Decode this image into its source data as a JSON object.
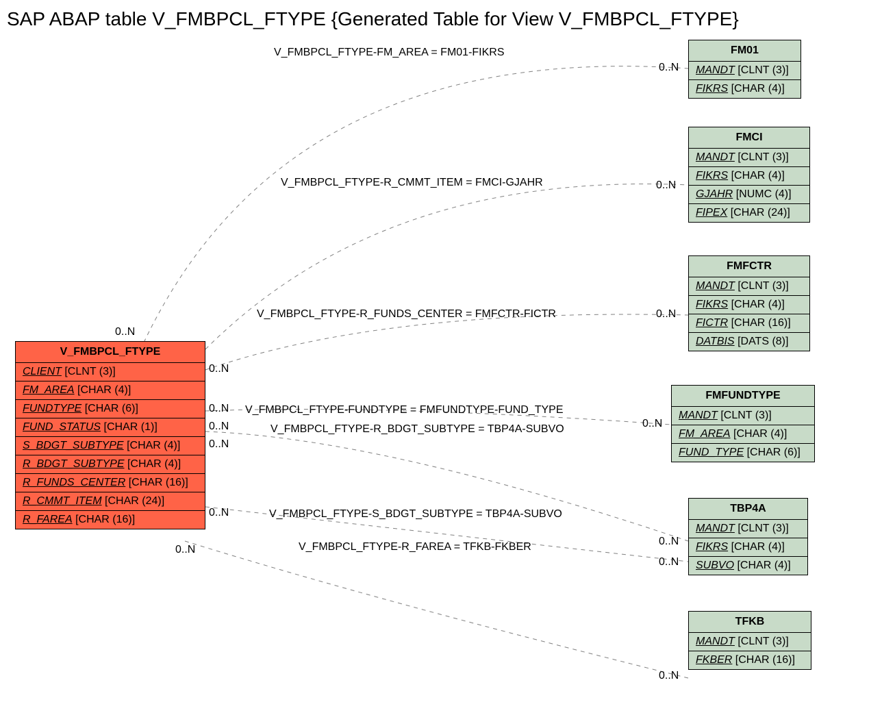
{
  "title": "SAP ABAP table V_FMBPCL_FTYPE {Generated Table for View V_FMBPCL_FTYPE}",
  "main_entity": {
    "name": "V_FMBPCL_FTYPE",
    "fields": [
      {
        "name": "CLIENT",
        "type": "[CLNT (3)]"
      },
      {
        "name": "FM_AREA",
        "type": "[CHAR (4)]"
      },
      {
        "name": "FUNDTYPE",
        "type": "[CHAR (6)]"
      },
      {
        "name": "FUND_STATUS",
        "type": "[CHAR (1)]"
      },
      {
        "name": "S_BDGT_SUBTYPE",
        "type": "[CHAR (4)]"
      },
      {
        "name": "R_BDGT_SUBTYPE",
        "type": "[CHAR (4)]"
      },
      {
        "name": "R_FUNDS_CENTER",
        "type": "[CHAR (16)]"
      },
      {
        "name": "R_CMMT_ITEM",
        "type": "[CHAR (24)]"
      },
      {
        "name": "R_FAREA",
        "type": "[CHAR (16)]"
      }
    ]
  },
  "ref_entities": [
    {
      "name": "FM01",
      "fields": [
        {
          "name": "MANDT",
          "type": "[CLNT (3)]"
        },
        {
          "name": "FIKRS",
          "type": "[CHAR (4)]"
        }
      ]
    },
    {
      "name": "FMCI",
      "fields": [
        {
          "name": "MANDT",
          "type": "[CLNT (3)]"
        },
        {
          "name": "FIKRS",
          "type": "[CHAR (4)]"
        },
        {
          "name": "GJAHR",
          "type": "[NUMC (4)]"
        },
        {
          "name": "FIPEX",
          "type": "[CHAR (24)]"
        }
      ]
    },
    {
      "name": "FMFCTR",
      "fields": [
        {
          "name": "MANDT",
          "type": "[CLNT (3)]"
        },
        {
          "name": "FIKRS",
          "type": "[CHAR (4)]"
        },
        {
          "name": "FICTR",
          "type": "[CHAR (16)]"
        },
        {
          "name": "DATBIS",
          "type": "[DATS (8)]"
        }
      ]
    },
    {
      "name": "FMFUNDTYPE",
      "fields": [
        {
          "name": "MANDT",
          "type": "[CLNT (3)]"
        },
        {
          "name": "FM_AREA",
          "type": "[CHAR (4)]"
        },
        {
          "name": "FUND_TYPE",
          "type": "[CHAR (6)]"
        }
      ]
    },
    {
      "name": "TBP4A",
      "fields": [
        {
          "name": "MANDT",
          "type": "[CLNT (3)]"
        },
        {
          "name": "FIKRS",
          "type": "[CHAR (4)]"
        },
        {
          "name": "SUBVO",
          "type": "[CHAR (4)]"
        }
      ]
    },
    {
      "name": "TFKB",
      "fields": [
        {
          "name": "MANDT",
          "type": "[CLNT (3)]"
        },
        {
          "name": "FKBER",
          "type": "[CHAR (16)]"
        }
      ]
    }
  ],
  "connections": [
    {
      "label": "V_FMBPCL_FTYPE-FM_AREA = FM01-FIKRS"
    },
    {
      "label": "V_FMBPCL_FTYPE-R_CMMT_ITEM = FMCI-GJAHR"
    },
    {
      "label": "V_FMBPCL_FTYPE-R_FUNDS_CENTER = FMFCTR-FICTR"
    },
    {
      "label": "V_FMBPCL_FTYPE-FUNDTYPE = FMFUNDTYPE-FUND_TYPE"
    },
    {
      "label": "V_FMBPCL_FTYPE-R_BDGT_SUBTYPE = TBP4A-SUBVO"
    },
    {
      "label": "V_FMBPCL_FTYPE-S_BDGT_SUBTYPE = TBP4A-SUBVO"
    },
    {
      "label": "V_FMBPCL_FTYPE-R_FAREA = TFKB-FKBER"
    }
  ],
  "cardinality": "0..N"
}
